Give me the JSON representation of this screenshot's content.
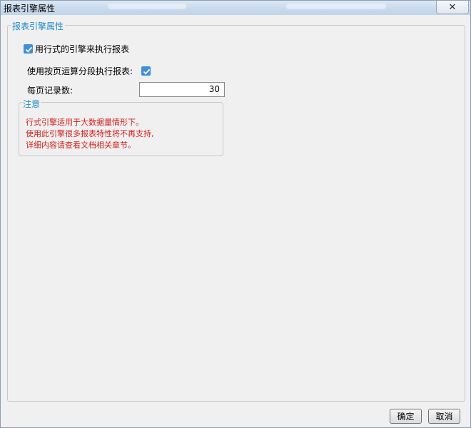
{
  "window": {
    "title": "报表引擎属性",
    "close_label": "✕"
  },
  "group": {
    "legend": "报表引擎属性"
  },
  "options": {
    "row_engine_label": "用行式的引擎来执行报表",
    "row_engine_checked": true,
    "paging_label": "使用按页运算分段执行报表:",
    "paging_checked": true,
    "records_per_page_label": "每页记录数:",
    "records_per_page_value": "30"
  },
  "note": {
    "legend": "注意",
    "lines": [
      "行式引擎适用于大数据量情形下。",
      "使用此引擎很多报表特性将不再支持,",
      "详细内容请查看文档相关章节。"
    ]
  },
  "buttons": {
    "ok_label": "确定",
    "cancel_label": "取消"
  }
}
